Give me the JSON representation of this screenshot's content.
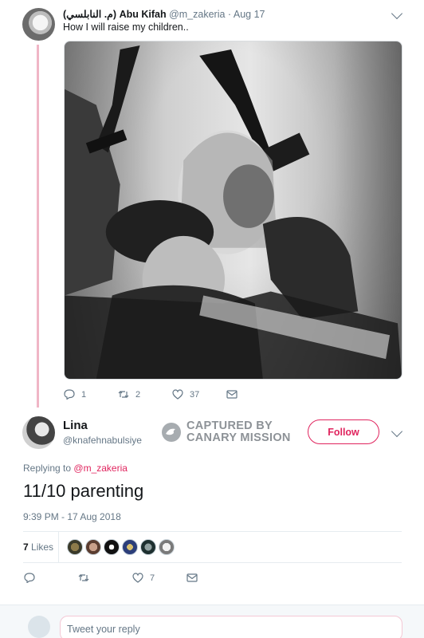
{
  "tweet1": {
    "display_name_arabic": "(م. النابلسي)",
    "display_name": "Abu Kifah",
    "handle": "@m_zakeria",
    "date": "Aug 17",
    "text": "How I will raise my children..",
    "image_alt": "black-and-white photo of children holding rifles",
    "stats": {
      "replies": "1",
      "retweets": "2",
      "likes": "37"
    }
  },
  "tweet2": {
    "display_name": "Lina",
    "handle": "@knafehnabulsiye",
    "follow_label": "Follow",
    "replying_prefix": "Replying to",
    "replying_to": "@m_zakeria",
    "text": "11/10 parenting",
    "timestamp": "9:39 PM - 17 Aug 2018",
    "likes_count": "7",
    "likes_label": "Likes",
    "action_likes": "7"
  },
  "watermark": {
    "line1": "CAPTURED BY",
    "line2": "CANARY MISSION"
  },
  "reply_box": {
    "placeholder": "Tweet your reply"
  },
  "colors": {
    "accent": "#e0245e",
    "thread_line": "#f0b6c6",
    "muted": "#657786"
  },
  "icons": [
    "reply-icon",
    "retweet-icon",
    "heart-icon",
    "mail-icon",
    "chevron-down-icon",
    "canary-logo-icon"
  ]
}
